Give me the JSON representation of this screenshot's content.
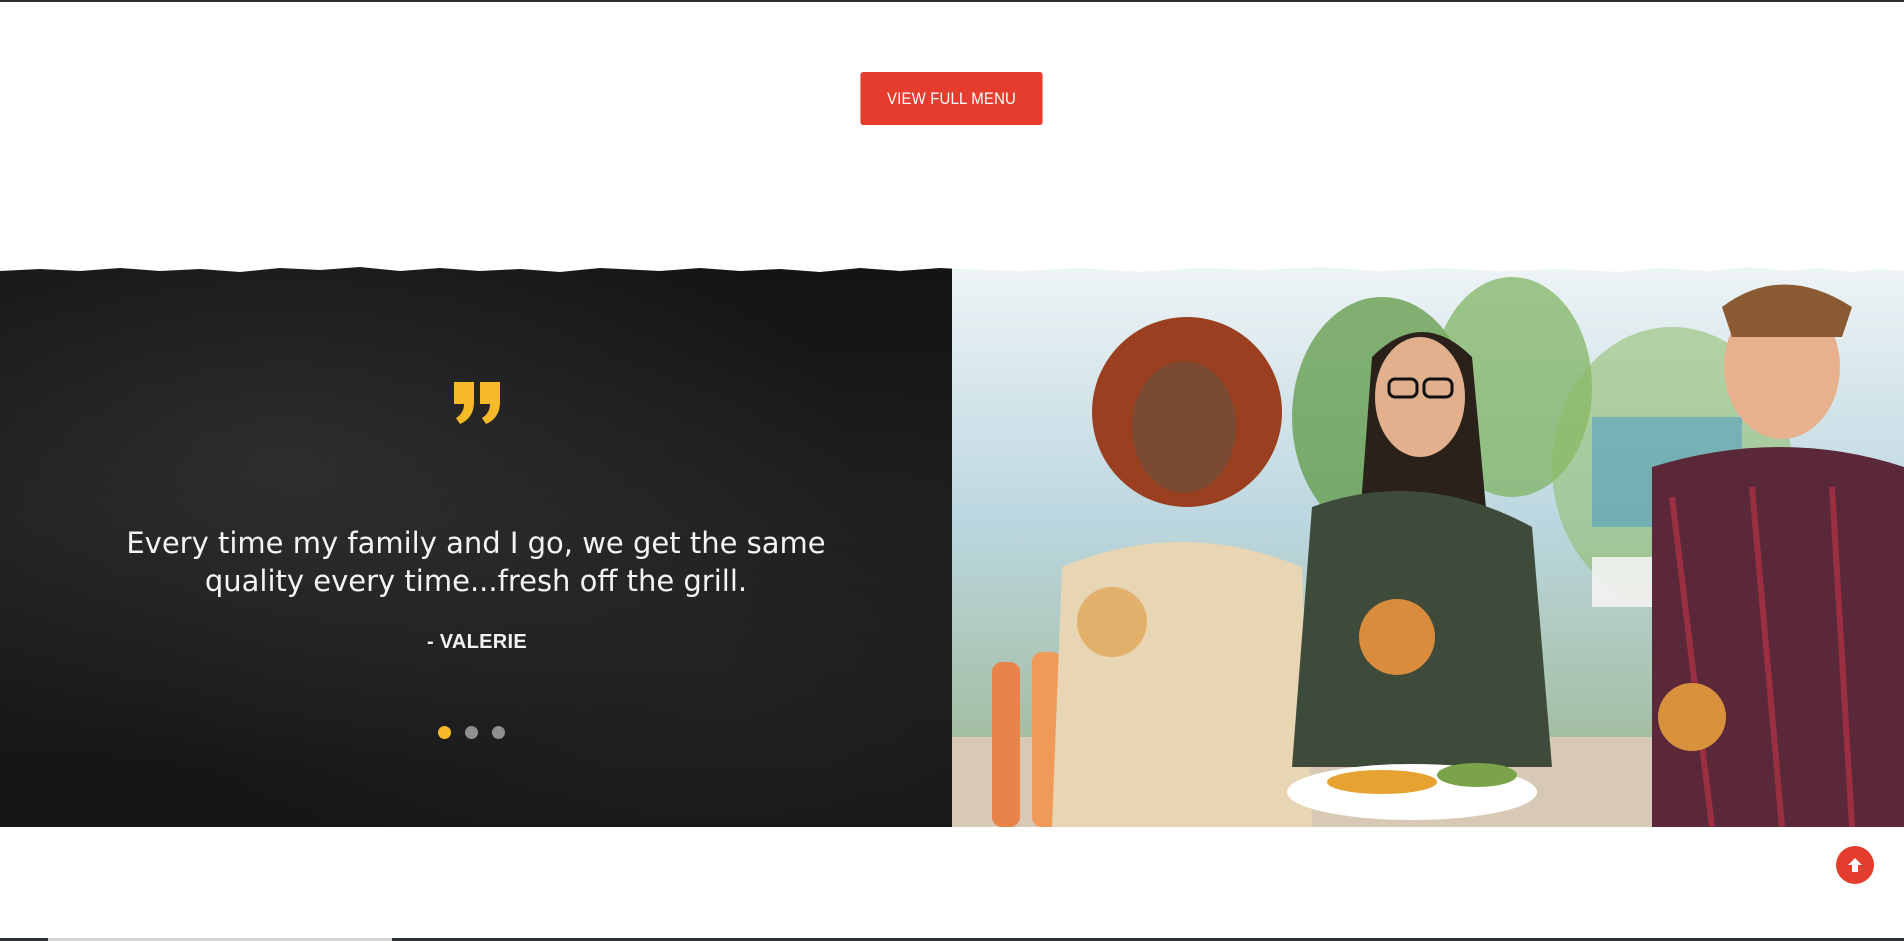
{
  "menu_button": {
    "label": "VIEW FULL MENU"
  },
  "testimonial": {
    "quote": "Every time my family and I go, we get the same quality every time...fresh off the grill.",
    "author": "-  VALERIE",
    "slides": 3,
    "active_slide": 1
  },
  "photo": {
    "description_icon": "diners-eating-burgers-photo"
  },
  "colors": {
    "accent_red": "#e63c2e",
    "quote_yellow": "#f7b927",
    "dark_panel": "#1a1a1a",
    "dot_inactive": "#8f8f8f"
  },
  "icons": {
    "quote": "quote-icon",
    "back_to_top": "arrow-up-icon"
  }
}
